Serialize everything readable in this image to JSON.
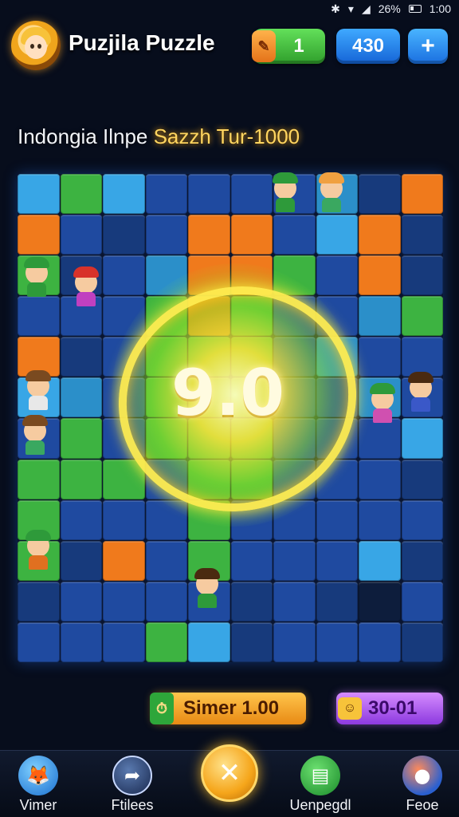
{
  "status_bar": {
    "battery": "26%",
    "time": "1:00",
    "icons": [
      "signal-icon",
      "wifi-icon",
      "cell-icon",
      "battery-icon"
    ]
  },
  "header": {
    "title": "Puzjila Puzzle",
    "hint_count": "1",
    "coins": "430",
    "add_label": "+"
  },
  "subtitle": {
    "part1": "Indongia Ilnpe ",
    "part2": "Sazzh Tur-1000"
  },
  "board": {
    "score": "9.0"
  },
  "timer": {
    "label": "Simer 1.00"
  },
  "moves": {
    "label": "30-01"
  },
  "nav": {
    "items": [
      {
        "label": "Vimer",
        "icon": "fox-icon"
      },
      {
        "label": "Ftilees",
        "icon": "share-icon"
      },
      {
        "label": "Uenpegdl",
        "icon": "book-icon"
      },
      {
        "label": "Feoe",
        "icon": "mascot-icon"
      }
    ],
    "center_icon": "close-icon",
    "center_label": "✕"
  },
  "colors": {
    "accent_gold": "#ffd560",
    "coins_blue": "#1e78e6",
    "hint_green": "#3fbd3a",
    "moves_purple": "#a855f7"
  }
}
